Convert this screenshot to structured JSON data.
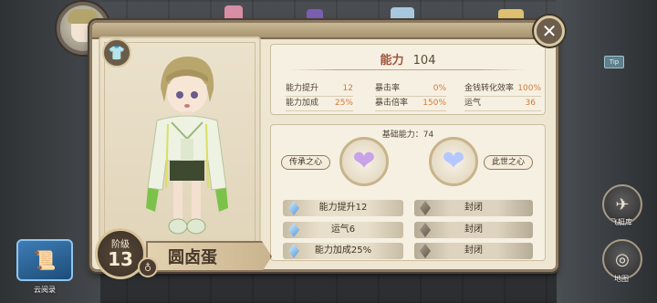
{
  "header": {
    "close_symbol": "✕"
  },
  "wardrobe": {
    "icon_symbol": "👕"
  },
  "tip_badge": "Tip",
  "side_buttons": {
    "airship_label": "飞艇库",
    "map_label": "地图",
    "cloud_label": "云阅录"
  },
  "character": {
    "level_label": "阶级",
    "level": "13",
    "ring_symbol": "♁",
    "name": "圆卤蛋"
  },
  "stats": {
    "power_label": "能力",
    "power_value": "104",
    "row1": [
      {
        "label": "能力提升",
        "value": "12"
      },
      {
        "label": "暴击率",
        "value": "0%"
      },
      {
        "label": "金钱转化效率",
        "value": "100%"
      }
    ],
    "row2": [
      {
        "label": "能力加成",
        "value": "25%"
      },
      {
        "label": "暴击倍率",
        "value": "150%"
      },
      {
        "label": "运气",
        "value": "36"
      }
    ]
  },
  "base": {
    "title": "基础能力：74",
    "left_heart_label": "传承之心",
    "right_heart_label": "此世之心",
    "left_slots": [
      "能力提升12",
      "运气6",
      "能力加成25%"
    ],
    "right_slots": [
      "封闭",
      "封闭",
      "封闭"
    ]
  },
  "colors": {
    "accent": "#d27a3c",
    "power_label": "#a0533a",
    "panel_bg": "#efe6d2"
  }
}
